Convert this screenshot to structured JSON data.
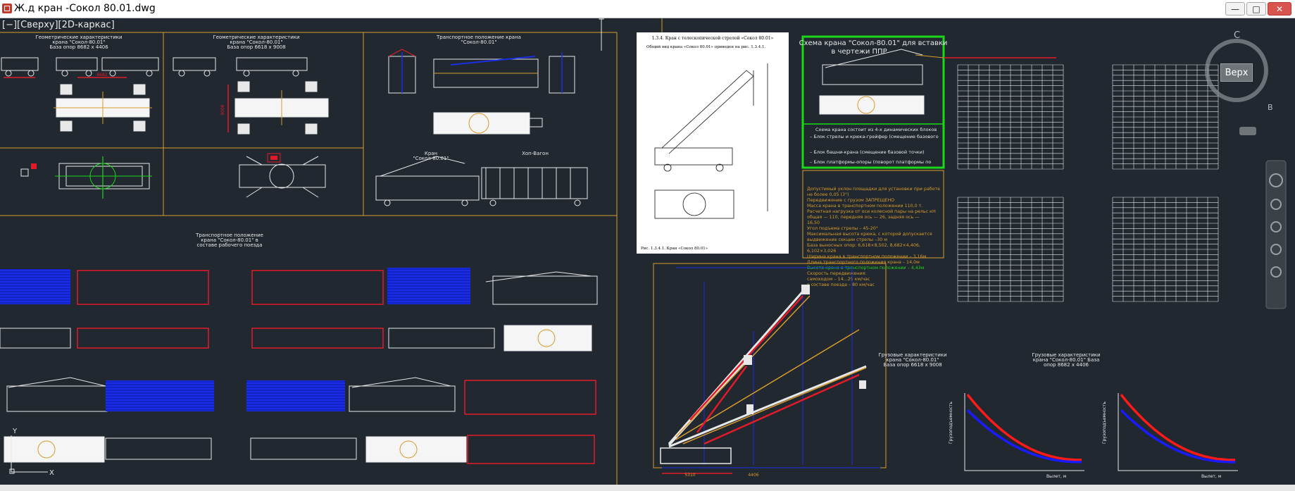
{
  "window": {
    "title": "Ж.д кран -Сокол 80.01.dwg",
    "minimize_glyph": "—",
    "maximize_glyph": "□",
    "close_glyph": "✕"
  },
  "viewport": {
    "label": "[−][Сверху][2D-каркас]"
  },
  "viewcube": {
    "label": "Верх",
    "compass_c": "С",
    "compass_v": "В"
  },
  "texts": {
    "geom1_title": "Геометрические характеристики",
    "geom1_sub": "крана \"Сокол-80.01\"",
    "geom1_base": "База опор 8682 х 4406",
    "geom2_title": "Геометрические характеристики",
    "geom2_sub": "крана \"Сокол-80.01\"",
    "geom2_base": "База опор 6618 х 9008",
    "transport_title": "Транспортное положение крана",
    "transport_sub": "\"Сокол-80.01\"",
    "label_kran": "Кран",
    "label_kran_model": "\"Сокол-80.01\"",
    "label_vagon": "Хоп-Вагон",
    "train_title": "Транспортное положение",
    "train_sub": "крана \"Сокол-80.01\" в",
    "train_sub2": "составе рабочего поезда",
    "doc_heading": "1.3.4. Кран с телескопической стрелой «Сокол 80.01»",
    "doc_line": "Общий вид крана «Сокол 80.01» приведен на рис. 1.3.4.1.",
    "doc_caption": "Рис. 1.3.4.1. Кран «Сокол 80.01»",
    "scheme_title": "Схема крана \"Сокол-80.01\" для вставки",
    "scheme_sub": "в чертежи ППР",
    "scheme_desc1": "Схема крана состоит из 4-х динамических блоков",
    "scheme_desc2": "– Блок стрелы и крюка-грейфер (смещение базового",
    "scheme_desc3": "– Блок башни-крана (смещение базовой точки)",
    "scheme_desc4": "– Блок платформы-опоры (поворот платформы по",
    "spec_1": "Допустимый уклон площадки для установки при работе",
    "spec_2": "не более 0,05 (3°)",
    "spec_3": "Передвижение с грузом ЗАПРЕЩЕНО",
    "spec_4": "Масса крана в транспортном положении 110,0 т.",
    "spec_5": "Расчетная нагрузка от оси колесной пары на рельс кН",
    "spec_6": "общая — 110, передняя ось — 26, задняя ось —",
    "spec_7": "16,50",
    "spec_8": "Угол подъема стрелы – 45-20°",
    "spec_9": "Максимальная высота крюка, с которой допускается",
    "spec_10": "выдвижение секции стрелы –30 м",
    "spec_11": "База выносных опор: 6,618×8,502, 8,682×4,406,",
    "spec_12": "6,102×3,026",
    "spec_13": "Ширина крана в транспортном положении – 3,16м",
    "spec_14": "Длина транспортного положения крана – 14,0м",
    "spec_15": "Высота крана в транспортном положении – 4,43м",
    "spec_16": "Скорость передвижения:",
    "spec_17": "самоходом – 14...25 км/час",
    "spec_18": "в составе поезда – 80 км/час",
    "load1_title": "Грузовые характеристики",
    "load1_sub": "крана \"Сокол-80.01\"",
    "load1_base": "База опор 6618 х 9008",
    "load2_title": "Грузовые характеристики",
    "load2_sub": "крана \"Сокол-80.01\" База",
    "load2_base": "опор 8682 х 4406",
    "axis_y": "Грузоподъемность",
    "axis_x": "Вылет, м",
    "dim_8682": "8682",
    "dim_5310": "5310",
    "dim_4406": "4406",
    "dim_9008": "9008"
  },
  "colors": {
    "background": "#212830",
    "line_white": "#e8e8e8",
    "line_red": "#e21b2a",
    "line_blue": "#1a2ee6",
    "frame_orange": "#d79b2b",
    "highlight_green": "#1bd81b",
    "load_red": "#ff1a1a",
    "load_blue": "#1a1aff"
  }
}
